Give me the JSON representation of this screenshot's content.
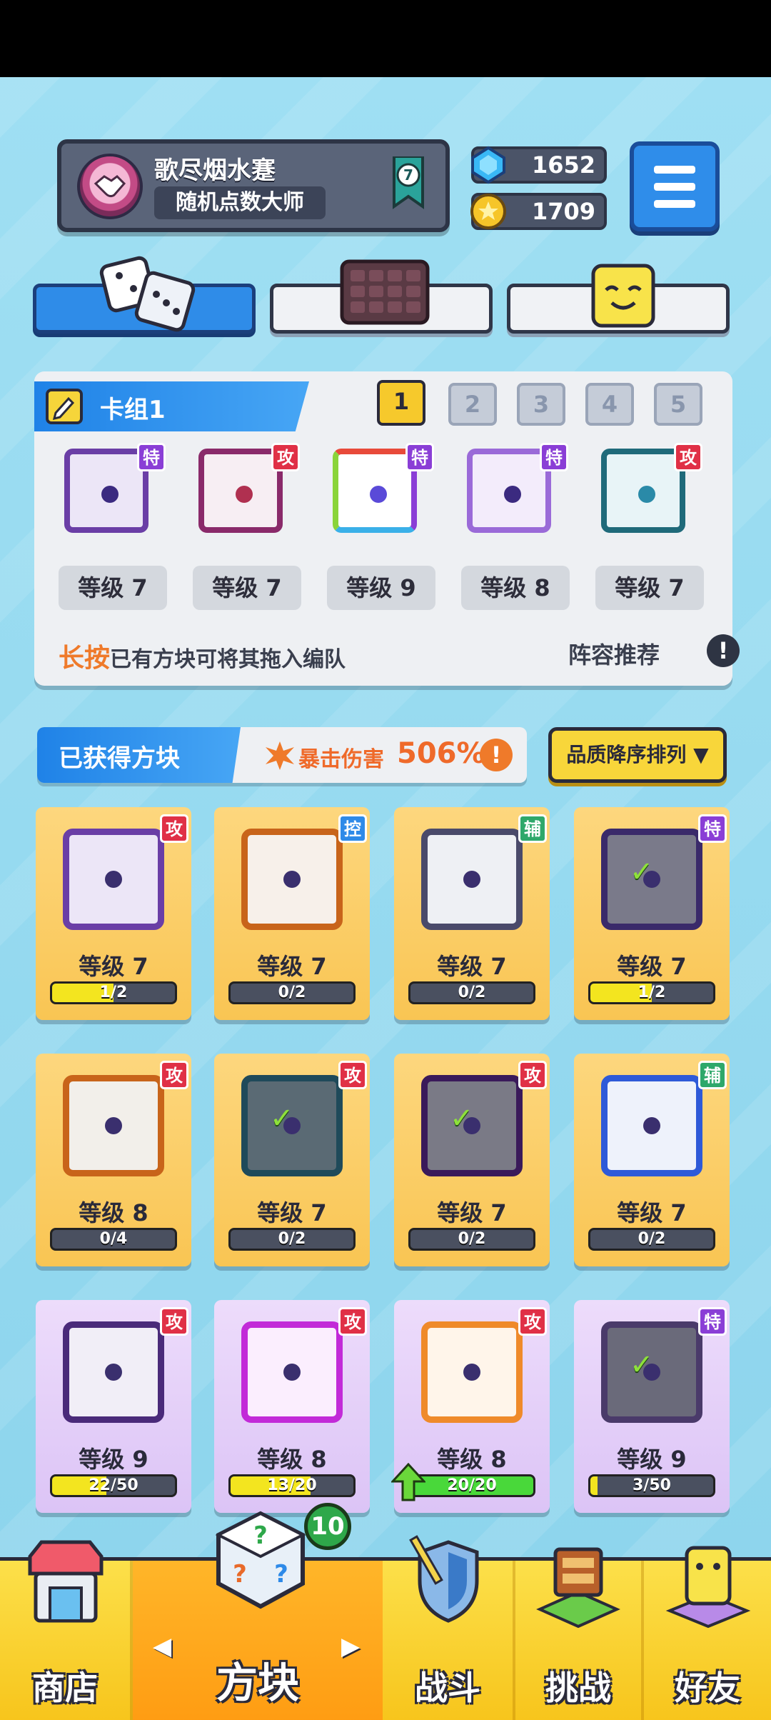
{
  "player": {
    "name": "歌尽烟水蹇",
    "title": "随机点数大师",
    "rank": "7"
  },
  "currency": {
    "gems": "1652",
    "coins": "1709"
  },
  "deck": {
    "title": "卡组1",
    "tabs": [
      "1",
      "2",
      "3",
      "4",
      "5"
    ],
    "active_tab": "1",
    "cards": [
      {
        "tag": "特",
        "level": "等级 7"
      },
      {
        "tag": "攻",
        "level": "等级 7"
      },
      {
        "tag": "特",
        "level": "等级 9"
      },
      {
        "tag": "特",
        "level": "等级 8"
      },
      {
        "tag": "攻",
        "level": "等级 7"
      }
    ],
    "hint_highlight": "长按",
    "hint_rest": "已有方块可将其拖入编队",
    "recommend": "阵容推荐",
    "info": "!"
  },
  "owned": {
    "title": "已获得方块",
    "crit_label": "暴击伤害",
    "crit_value": "506%",
    "info": "!",
    "sort_label": "品质降序排列 ▼",
    "blocks": [
      {
        "tag": "攻",
        "level": "等级 7",
        "progress": "1/2",
        "ratio": 0.5,
        "rarity": "gold",
        "check": ""
      },
      {
        "tag": "控",
        "level": "等级 7",
        "progress": "0/2",
        "ratio": 0,
        "rarity": "gold",
        "check": ""
      },
      {
        "tag": "辅",
        "level": "等级 7",
        "progress": "0/2",
        "ratio": 0,
        "rarity": "gold",
        "check": ""
      },
      {
        "tag": "特",
        "level": "等级 7",
        "progress": "1/2",
        "ratio": 0.5,
        "rarity": "gold",
        "check": "✓"
      },
      {
        "tag": "攻",
        "level": "等级 8",
        "progress": "0/4",
        "ratio": 0,
        "rarity": "gold",
        "check": ""
      },
      {
        "tag": "攻",
        "level": "等级 7",
        "progress": "0/2",
        "ratio": 0,
        "rarity": "gold",
        "check": "✓"
      },
      {
        "tag": "攻",
        "level": "等级 7",
        "progress": "0/2",
        "ratio": 0,
        "rarity": "gold",
        "check": "✓"
      },
      {
        "tag": "辅",
        "level": "等级 7",
        "progress": "0/2",
        "ratio": 0,
        "rarity": "gold",
        "check": ""
      },
      {
        "tag": "攻",
        "level": "等级 9",
        "progress": "22/50",
        "ratio": 0.44,
        "rarity": "purple",
        "check": ""
      },
      {
        "tag": "攻",
        "level": "等级 8",
        "progress": "13/20",
        "ratio": 0.65,
        "rarity": "purple",
        "check": ""
      },
      {
        "tag": "攻",
        "level": "等级 8",
        "progress": "20/20",
        "ratio": 1,
        "rarity": "purple",
        "check": ""
      },
      {
        "tag": "特",
        "level": "等级 9",
        "progress": "3/50",
        "ratio": 0.06,
        "rarity": "purple",
        "check": "✓"
      }
    ]
  },
  "nav": {
    "shop": "商店",
    "blocks": "方块",
    "battle": "战斗",
    "challenge": "挑战",
    "friends": "好友",
    "blocks_badge": "10",
    "arrow_left": "◀",
    "arrow_right": "▶"
  },
  "colors": {
    "attack": "#e03046",
    "special": "#8a3ed6",
    "control": "#2e8ae8",
    "support": "#2ea86a",
    "accent_blue": "#2f8ce8",
    "accent_yellow": "#f8d63a"
  }
}
